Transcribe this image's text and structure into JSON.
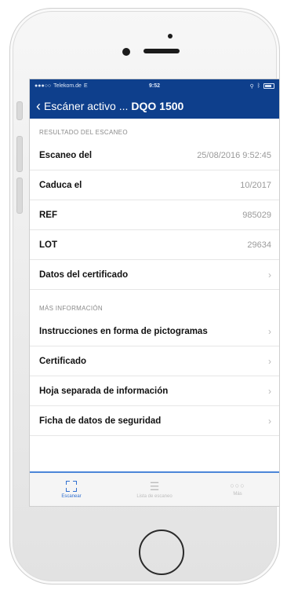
{
  "status_bar": {
    "carrier": "Telekom.de",
    "network": "E",
    "time": "9:52"
  },
  "nav": {
    "back_label": "Escáner activo ...",
    "title": "DQO 1500"
  },
  "sections": [
    {
      "header": "RESULTADO DEL ESCANEO",
      "rows": [
        {
          "label": "Escaneo del",
          "value": "25/08/2016 9:52:45"
        },
        {
          "label": "Caduca el",
          "value": "10/2017"
        },
        {
          "label": "REF",
          "value": "985029"
        },
        {
          "label": "LOT",
          "value": "29634"
        },
        {
          "label": "Datos del certificado",
          "chevron": true
        }
      ]
    },
    {
      "header": "MÁS INFORMACIÓN",
      "rows": [
        {
          "label": "Instrucciones en forma de pictogramas",
          "chevron": true
        },
        {
          "label": "Certificado",
          "chevron": true
        },
        {
          "label": "Hoja separada de información",
          "chevron": true
        },
        {
          "label": "Ficha de datos de seguridad",
          "chevron": true
        }
      ]
    }
  ],
  "tabbar": [
    {
      "label": "Escanear",
      "icon": "scan-frame-icon",
      "active": true
    },
    {
      "label": "Lista de escaneo",
      "icon": "list-icon",
      "active": false
    },
    {
      "label": "Más",
      "icon": "more-dots-icon",
      "active": false
    }
  ],
  "colors": {
    "nav_bg": "#0e3f8c",
    "accent": "#2f6fd0",
    "muted_text": "#9a9a9a"
  }
}
